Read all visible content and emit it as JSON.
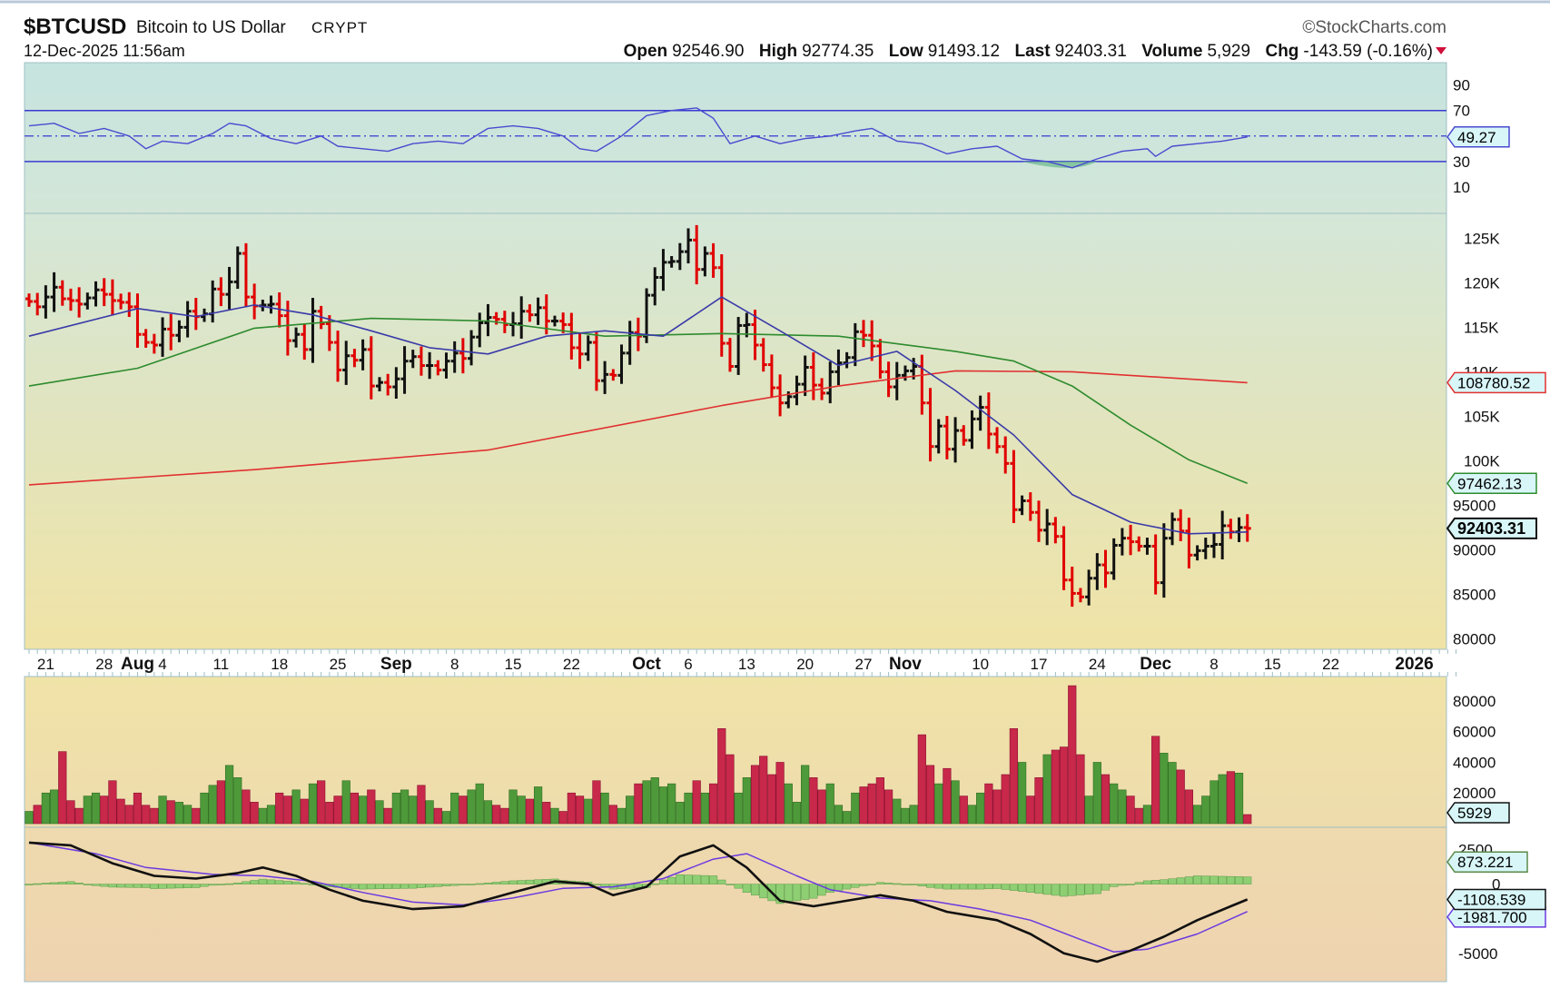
{
  "header": {
    "symbol": "$BTCUSD",
    "name": "Bitcoin to US Dollar",
    "exchange": "CRYPT",
    "datetime": "12-Dec-2025 11:56am",
    "copyright": "©StockCharts.com",
    "open_label": "Open",
    "open": "92546.90",
    "high_label": "High",
    "high": "92774.35",
    "low_label": "Low",
    "low": "91493.12",
    "last_label": "Last",
    "last": "92403.31",
    "volume_label": "Volume",
    "volume": "5,929",
    "chg_label": "Chg",
    "chg": "-143.59 (-0.16%)",
    "chg_direction_icon": "down-triangle"
  },
  "colors": {
    "up_bar": "#111111",
    "down_bar": "#e00000",
    "ma20": "#3a3aa8",
    "ma50": "#2e8b2e",
    "ma200": "#e03030",
    "vol_up": "#4e9a3a",
    "vol_down": "#c8284a",
    "rsi": "#4a4ad0",
    "macd": "#111111",
    "signal": "#6a3ae0",
    "hist": "#8fcf74"
  },
  "chart_data": [
    {
      "type": "bar",
      "title": "$BTCUSD daily OHLC price (K USD)",
      "start_date": "2025-07-19",
      "end_date": "2025-12-12",
      "unit": "thousand USD",
      "closes_k": [
        117.9,
        117.3,
        118.4,
        119.5,
        118.2,
        118.0,
        117.6,
        118.3,
        119.2,
        118.7,
        118.0,
        117.8,
        117.3,
        114.2,
        113.3,
        113.0,
        114.8,
        114.1,
        115.0,
        116.8,
        116.2,
        116.5,
        119.3,
        118.7,
        120.1,
        123.3,
        118.4,
        117.4,
        117.5,
        117.6,
        116.3,
        113.5,
        114.2,
        112.5,
        116.8,
        115.4,
        113.3,
        110.2,
        111.8,
        111.3,
        112.5,
        108.4,
        108.8,
        108.3,
        109.2,
        111.2,
        111.7,
        110.7,
        110.7,
        110.2,
        111.2,
        112.1,
        111.5,
        113.9,
        115.5,
        116.1,
        115.9,
        115.3,
        115.4,
        116.8,
        116.4,
        117.2,
        115.7,
        115.7,
        115.3,
        112.7,
        112.0,
        113.3,
        109.0,
        109.7,
        109.6,
        112.1,
        114.4,
        114.0,
        118.6,
        120.6,
        122.3,
        122.4,
        123.5,
        124.8,
        121.5,
        123.3,
        121.7,
        113.2,
        110.6,
        115.2,
        115.3,
        113.0,
        110.8,
        108.2,
        106.5,
        107.2,
        108.6,
        110.5,
        108.5,
        107.6,
        110.0,
        111.0,
        111.6,
        114.5,
        114.1,
        112.9,
        110.0,
        108.3,
        109.6,
        110.1,
        110.6,
        106.5,
        101.6,
        103.9,
        101.3,
        103.4,
        102.3,
        104.7,
        106.0,
        103.0,
        101.6,
        99.7,
        94.5,
        95.5,
        94.2,
        92.2,
        92.9,
        91.5,
        86.6,
        85.1,
        84.7,
        86.8,
        88.3,
        87.4,
        90.5,
        91.3,
        90.9,
        90.4,
        90.4,
        86.3,
        91.3,
        93.4,
        92.1,
        89.4,
        89.9,
        90.4,
        90.6,
        92.7,
        92.0,
        92.5,
        92.4
      ],
      "ma20_k": [
        [
          0,
          114
        ],
        [
          13,
          117.1
        ],
        [
          20,
          116.2
        ],
        [
          27,
          117.5
        ],
        [
          34,
          116.4
        ],
        [
          41,
          114.6
        ],
        [
          48,
          112.7
        ],
        [
          55,
          112
        ],
        [
          62,
          114
        ],
        [
          69,
          114.6
        ],
        [
          76,
          114
        ],
        [
          83,
          118.4
        ],
        [
          90,
          114.6
        ],
        [
          97,
          110.7
        ],
        [
          104,
          112.3
        ],
        [
          111,
          107.9
        ],
        [
          118,
          102.9
        ],
        [
          125,
          96.2
        ],
        [
          132,
          93.1
        ],
        [
          139,
          91.8
        ],
        [
          146,
          92
        ]
      ],
      "ma50_k": [
        [
          0,
          108.4
        ],
        [
          13,
          110.4
        ],
        [
          27,
          114.9
        ],
        [
          41,
          116
        ],
        [
          55,
          115.7
        ],
        [
          69,
          114
        ],
        [
          83,
          114.3
        ],
        [
          97,
          114
        ],
        [
          111,
          112.3
        ],
        [
          118,
          111.2
        ],
        [
          125,
          108.4
        ],
        [
          132,
          104
        ],
        [
          139,
          100.1
        ],
        [
          146,
          97.46
        ]
      ],
      "ma200_k": [
        [
          0,
          97.3
        ],
        [
          27,
          99
        ],
        [
          55,
          101.2
        ],
        [
          83,
          106.2
        ],
        [
          97,
          108.4
        ],
        [
          111,
          110.1
        ],
        [
          125,
          110
        ],
        [
          146,
          108.78
        ]
      ],
      "y_ticks": [
        "125K",
        "120K",
        "115K",
        "110K",
        "105K",
        "100K",
        "95000",
        "90000",
        "85000",
        "80000"
      ],
      "y_tick_values_k": [
        125,
        120,
        115,
        110,
        105,
        100,
        95,
        90,
        85,
        80
      ],
      "ylim_k": [
        78.5,
        128.5
      ],
      "last_labels": {
        "ma200": "108780.52",
        "ma50": "97462.13",
        "last": "92403.31"
      }
    },
    {
      "type": "line",
      "title": "RSI(14)",
      "values": [
        [
          0,
          58
        ],
        [
          3,
          60
        ],
        [
          6,
          52
        ],
        [
          9,
          56
        ],
        [
          12,
          50
        ],
        [
          14,
          40
        ],
        [
          16,
          46
        ],
        [
          19,
          44
        ],
        [
          22,
          52
        ],
        [
          24,
          60
        ],
        [
          26,
          58
        ],
        [
          29,
          48
        ],
        [
          32,
          44
        ],
        [
          35,
          50
        ],
        [
          37,
          42
        ],
        [
          40,
          40
        ],
        [
          43,
          38
        ],
        [
          46,
          44
        ],
        [
          49,
          46
        ],
        [
          52,
          44
        ],
        [
          55,
          56
        ],
        [
          58,
          58
        ],
        [
          61,
          56
        ],
        [
          64,
          50
        ],
        [
          66,
          40
        ],
        [
          68,
          38
        ],
        [
          71,
          50
        ],
        [
          74,
          66
        ],
        [
          77,
          70
        ],
        [
          80,
          72
        ],
        [
          82,
          64
        ],
        [
          84,
          44
        ],
        [
          87,
          50
        ],
        [
          90,
          44
        ],
        [
          93,
          48
        ],
        [
          96,
          50
        ],
        [
          99,
          54
        ],
        [
          101,
          56
        ],
        [
          104,
          46
        ],
        [
          107,
          44
        ],
        [
          110,
          36
        ],
        [
          113,
          40
        ],
        [
          116,
          42
        ],
        [
          119,
          32
        ],
        [
          122,
          30
        ],
        [
          125,
          25
        ],
        [
          128,
          32
        ],
        [
          131,
          38
        ],
        [
          134,
          40
        ],
        [
          135,
          34
        ],
        [
          137,
          42
        ],
        [
          140,
          44
        ],
        [
          143,
          46
        ],
        [
          146,
          49.27
        ]
      ],
      "y_ticks": [
        "90",
        "70",
        "30",
        "10"
      ],
      "y_tick_values": [
        90,
        70,
        30,
        10
      ],
      "levels": [
        70,
        50,
        30
      ],
      "last_label": "49.27"
    },
    {
      "type": "bar",
      "title": "Volume (thousands)",
      "values_k": [
        8,
        12,
        20,
        22,
        47,
        15,
        10,
        18,
        20,
        18,
        28,
        16,
        12,
        20,
        12,
        10,
        18,
        15,
        14,
        12,
        10,
        20,
        25,
        28,
        38,
        30,
        22,
        14,
        10,
        12,
        20,
        18,
        22,
        16,
        26,
        28,
        14,
        18,
        28,
        20,
        18,
        22,
        15,
        10,
        20,
        22,
        18,
        25,
        15,
        10,
        8,
        20,
        18,
        22,
        26,
        15,
        12,
        10,
        22,
        18,
        16,
        24,
        14,
        10,
        8,
        20,
        18,
        16,
        28,
        20,
        12,
        10,
        18,
        26,
        28,
        30,
        24,
        26,
        14,
        20,
        28,
        20,
        26,
        62,
        45,
        20,
        30,
        38,
        44,
        32,
        40,
        26,
        14,
        38,
        30,
        22,
        26,
        12,
        8,
        20,
        24,
        26,
        30,
        22,
        16,
        10,
        12,
        58,
        38,
        26,
        36,
        28,
        18,
        12,
        20,
        26,
        22,
        32,
        62,
        40,
        18,
        30,
        45,
        48,
        50,
        90,
        45,
        18,
        40,
        32,
        26,
        22,
        18,
        10,
        12,
        57,
        46,
        40,
        35,
        22,
        12,
        18,
        28,
        32,
        34,
        33,
        5.929
      ],
      "y_ticks": [
        "80000",
        "60000",
        "40000",
        "20000"
      ],
      "y_tick_values_k": [
        80,
        60,
        40,
        20
      ],
      "last_label": "5929"
    },
    {
      "type": "line",
      "title": "MACD(12,26,9)",
      "macd": [
        [
          0,
          3000
        ],
        [
          5,
          2800
        ],
        [
          10,
          1500
        ],
        [
          15,
          600
        ],
        [
          20,
          400
        ],
        [
          25,
          800
        ],
        [
          28,
          1200
        ],
        [
          32,
          600
        ],
        [
          36,
          -400
        ],
        [
          40,
          -1200
        ],
        [
          46,
          -1800
        ],
        [
          52,
          -1600
        ],
        [
          58,
          -600
        ],
        [
          63,
          200
        ],
        [
          67,
          0
        ],
        [
          70,
          -800
        ],
        [
          74,
          -200
        ],
        [
          78,
          2000
        ],
        [
          82,
          2800
        ],
        [
          86,
          1200
        ],
        [
          90,
          -1200
        ],
        [
          94,
          -1600
        ],
        [
          98,
          -1200
        ],
        [
          102,
          -800
        ],
        [
          106,
          -1200
        ],
        [
          110,
          -2000
        ],
        [
          116,
          -2600
        ],
        [
          120,
          -3600
        ],
        [
          124,
          -5000
        ],
        [
          128,
          -5600
        ],
        [
          132,
          -4800
        ],
        [
          136,
          -3800
        ],
        [
          140,
          -2600
        ],
        [
          144,
          -1600
        ],
        [
          146,
          -1108.539
        ]
      ],
      "signal": [
        [
          0,
          3000
        ],
        [
          8,
          2200
        ],
        [
          14,
          1200
        ],
        [
          22,
          700
        ],
        [
          28,
          600
        ],
        [
          34,
          200
        ],
        [
          40,
          -600
        ],
        [
          46,
          -1300
        ],
        [
          52,
          -1500
        ],
        [
          58,
          -1000
        ],
        [
          64,
          -300
        ],
        [
          70,
          -200
        ],
        [
          76,
          400
        ],
        [
          82,
          1800
        ],
        [
          86,
          2200
        ],
        [
          92,
          600
        ],
        [
          96,
          -400
        ],
        [
          102,
          -1000
        ],
        [
          108,
          -1200
        ],
        [
          114,
          -1800
        ],
        [
          120,
          -2600
        ],
        [
          126,
          -4000
        ],
        [
          130,
          -4900
        ],
        [
          134,
          -4700
        ],
        [
          140,
          -3600
        ],
        [
          146,
          -1981.7
        ]
      ],
      "y_ticks": [
        "2500",
        "0",
        "-5000"
      ],
      "y_tick_values": [
        2500,
        0,
        -5000
      ],
      "last_labels": {
        "hist": "873.221",
        "macd": "-1108.539",
        "signal": "-1981.700"
      }
    }
  ],
  "x_axis": {
    "labels": [
      {
        "day": 2,
        "text": "21",
        "bold": false
      },
      {
        "day": 9,
        "text": "28",
        "bold": false
      },
      {
        "day": 13,
        "text": "Aug",
        "bold": true
      },
      {
        "day": 16,
        "text": "4",
        "bold": false
      },
      {
        "day": 23,
        "text": "11",
        "bold": false
      },
      {
        "day": 30,
        "text": "18",
        "bold": false
      },
      {
        "day": 37,
        "text": "25",
        "bold": false
      },
      {
        "day": 44,
        "text": "Sep",
        "bold": true
      },
      {
        "day": 51,
        "text": "8",
        "bold": false
      },
      {
        "day": 58,
        "text": "15",
        "bold": false
      },
      {
        "day": 65,
        "text": "22",
        "bold": false
      },
      {
        "day": 74,
        "text": "Oct",
        "bold": true
      },
      {
        "day": 79,
        "text": "6",
        "bold": false
      },
      {
        "day": 86,
        "text": "13",
        "bold": false
      },
      {
        "day": 93,
        "text": "20",
        "bold": false
      },
      {
        "day": 100,
        "text": "27",
        "bold": false
      },
      {
        "day": 105,
        "text": "Nov",
        "bold": true
      },
      {
        "day": 114,
        "text": "10",
        "bold": false
      },
      {
        "day": 121,
        "text": "17",
        "bold": false
      },
      {
        "day": 128,
        "text": "24",
        "bold": false
      },
      {
        "day": 135,
        "text": "Dec",
        "bold": true
      },
      {
        "day": 142,
        "text": "8",
        "bold": false
      },
      {
        "day": 149,
        "text": "15",
        "bold": false
      },
      {
        "day": 156,
        "text": "22",
        "bold": false
      },
      {
        "day": 166,
        "text": "2026",
        "bold": true
      }
    ]
  }
}
